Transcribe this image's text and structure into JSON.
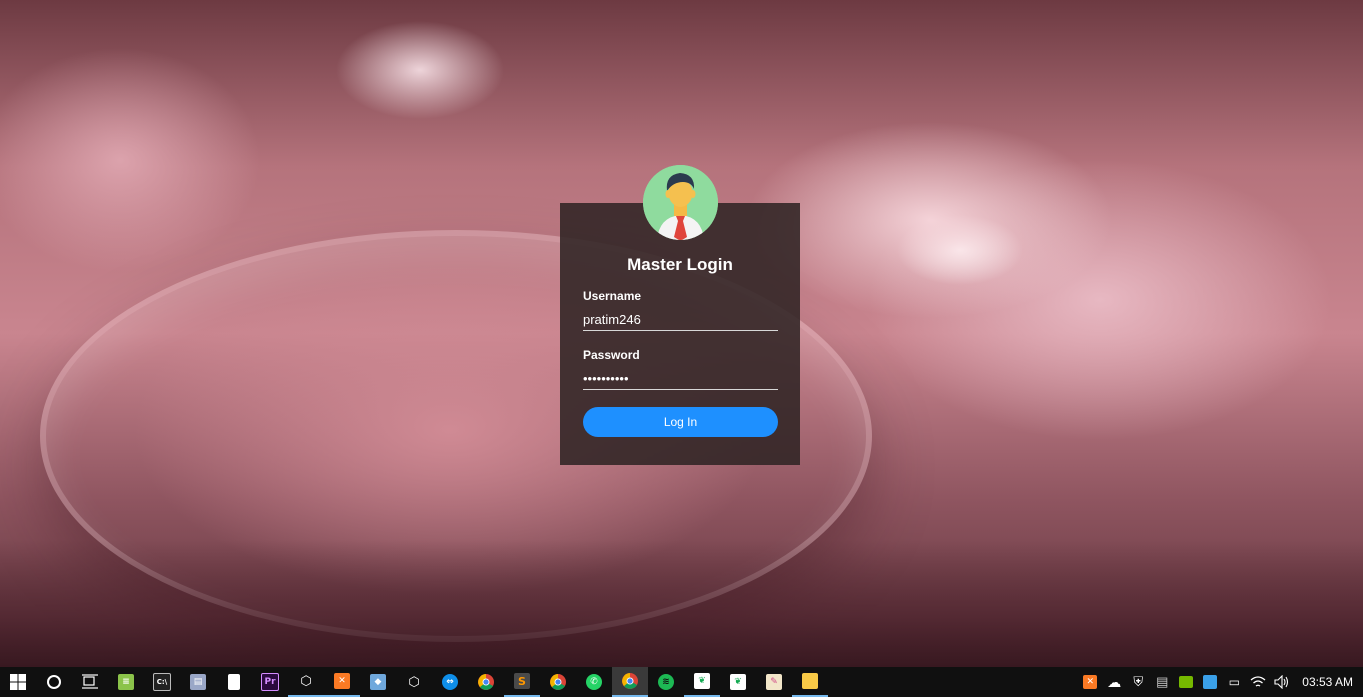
{
  "login": {
    "title": "Master Login",
    "username_label": "Username",
    "username_value": "pratim246",
    "password_label": "Password",
    "password_value": "••••••••••",
    "button_label": "Log In",
    "accent_color": "#1e90ff",
    "avatar_color": "#8fdb9e"
  },
  "taskbar": {
    "apps": [
      {
        "name": "start",
        "icon": "windows-icon"
      },
      {
        "name": "search",
        "icon": "cortana-circle-icon"
      },
      {
        "name": "task-view",
        "icon": "task-view-icon"
      },
      {
        "name": "notepad-plus",
        "icon": "notepad-plus-icon"
      },
      {
        "name": "command-prompt",
        "icon": "cmd-icon",
        "text": "C:\\"
      },
      {
        "name": "file-tool",
        "icon": "file-tool-icon"
      },
      {
        "name": "document",
        "icon": "document-icon"
      },
      {
        "name": "premiere",
        "icon": "premiere-icon",
        "text": "Pr"
      },
      {
        "name": "box-app",
        "icon": "box-outline-icon"
      },
      {
        "name": "xampp",
        "icon": "xampp-icon"
      },
      {
        "name": "virtualbox",
        "icon": "cube-icon"
      },
      {
        "name": "box-app-2",
        "icon": "box-outline-icon"
      },
      {
        "name": "teamviewer",
        "icon": "teamviewer-icon"
      },
      {
        "name": "chrome",
        "icon": "chrome-icon"
      },
      {
        "name": "sublime",
        "icon": "sublime-icon"
      },
      {
        "name": "chrome-2",
        "icon": "chrome-icon"
      },
      {
        "name": "whatsapp",
        "icon": "whatsapp-icon"
      },
      {
        "name": "chrome-active",
        "icon": "chrome-icon"
      },
      {
        "name": "spotify",
        "icon": "spotify-icon"
      },
      {
        "name": "mongodb",
        "icon": "mongodb-leaf-icon"
      },
      {
        "name": "mongodb-2",
        "icon": "mongodb-leaf-icon"
      },
      {
        "name": "paint",
        "icon": "paint-icon"
      },
      {
        "name": "file-explorer",
        "icon": "folder-icon"
      }
    ],
    "time": "03:53 AM"
  }
}
